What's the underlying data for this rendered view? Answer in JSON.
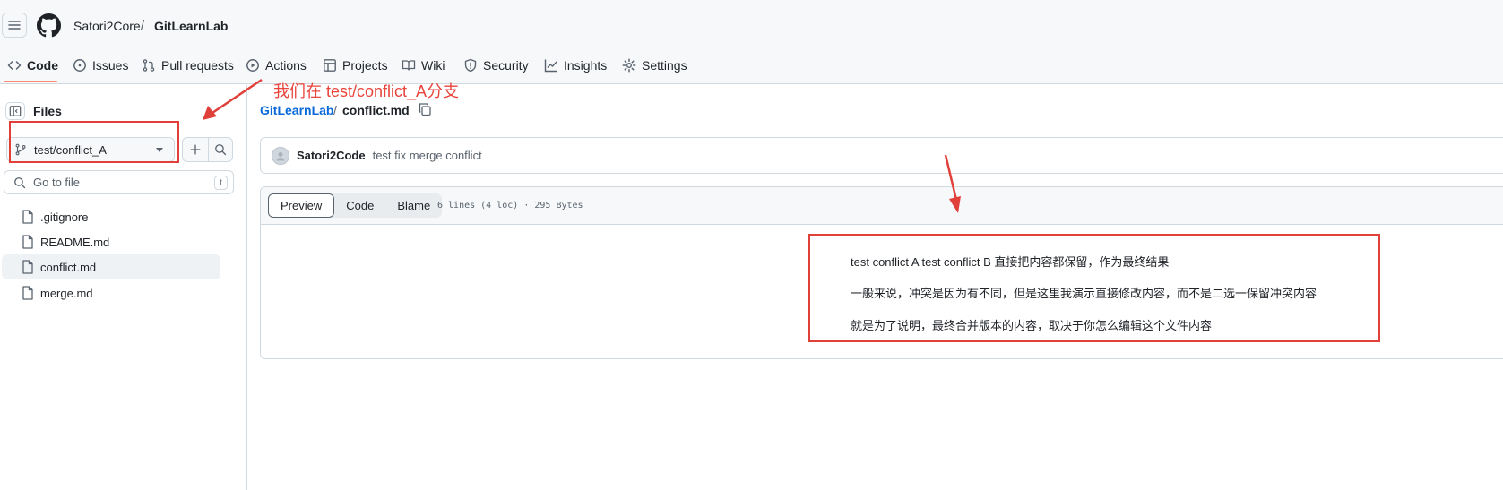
{
  "header": {
    "owner": "Satori2Core",
    "separator": "/",
    "repo": "GitLearnLab",
    "tabs": [
      {
        "label": "Code",
        "icon": "code-icon"
      },
      {
        "label": "Issues",
        "icon": "issue-opened-icon"
      },
      {
        "label": "Pull requests",
        "icon": "git-pull-request-icon"
      },
      {
        "label": "Actions",
        "icon": "play-icon"
      },
      {
        "label": "Projects",
        "icon": "table-icon"
      },
      {
        "label": "Wiki",
        "icon": "book-icon"
      },
      {
        "label": "Security",
        "icon": "shield-icon"
      },
      {
        "label": "Insights",
        "icon": "graph-icon"
      },
      {
        "label": "Settings",
        "icon": "gear-icon"
      }
    ],
    "active_tab": "Code"
  },
  "sidebar": {
    "title": "Files",
    "branch": "test/conflict_A",
    "search_placeholder": "Go to file",
    "search_shortcut": "t",
    "files": [
      {
        "name": ".gitignore",
        "active": false
      },
      {
        "name": "README.md",
        "active": false
      },
      {
        "name": "conflict.md",
        "active": true
      },
      {
        "name": "merge.md",
        "active": false
      }
    ]
  },
  "main": {
    "path_repo": "GitLearnLab",
    "path_sep": "/",
    "path_file": "conflict.md",
    "commit": {
      "author": "Satori2Code",
      "message": "test fix merge conflict"
    },
    "view_tabs": [
      "Preview",
      "Code",
      "Blame"
    ],
    "active_view": "Preview",
    "file_meta": "6 lines (4 loc) · 295 Bytes",
    "content": [
      "test conflict A test conflict B 直接把内容都保留，作为最终结果",
      "一般来说，冲突是因为有不同，但是这里我演示直接修改内容，而不是二选一保留冲突内容",
      "就是为了说明，最终合并版本的内容，取决于你怎么编辑这个文件内容"
    ]
  },
  "annotation": {
    "text": "我们在 test/conflict_A分支",
    "color": "#e8453c"
  },
  "colors": {
    "link": "#0969da",
    "border": "#d1d9e0",
    "tab_underline": "#fd8c73",
    "annotation_red": "#e0403a"
  }
}
